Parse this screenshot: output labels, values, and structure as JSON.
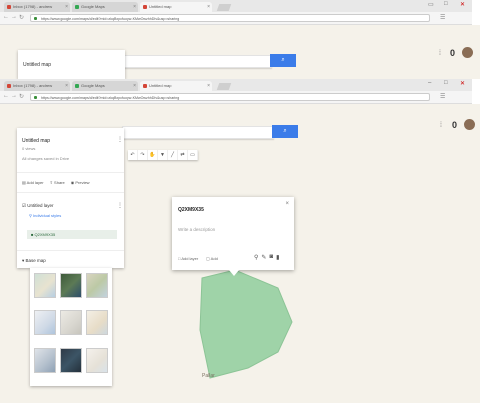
{
  "browser_back": {
    "tabs": [
      {
        "label": "Inbox (1798) - andrew",
        "favicon_color": "#d44638"
      },
      {
        "label": "Google Maps",
        "favicon_color": "#34a853"
      },
      {
        "label": "Untitled map",
        "favicon_color": "#d44638"
      }
    ],
    "url": "https://www.google.com/maps/d/edit?mid=zkqBxpcfuoyw-KMwOwzhhDIv&usp=sharing",
    "map_title": "Untitled map"
  },
  "browser": {
    "tabs": [
      {
        "label": "Inbox (1798) - andrew",
        "favicon_color": "#d44638"
      },
      {
        "label": "Google Maps",
        "favicon_color": "#34a853"
      },
      {
        "label": "Untitled map",
        "favicon_color": "#d44638"
      }
    ],
    "url": "https://www.google.com/maps/d/edit?mid=zkqBxpcfuoyw-KMwOwzhhDIv&usp=sharing",
    "window_controls": [
      "–",
      "□",
      "✕"
    ],
    "nav": [
      "←",
      "→",
      "↻"
    ]
  },
  "colors": {
    "accent": "#3b7ce9",
    "polygon_fill": "#9fd3a8",
    "map_bg": "#f5f2ea"
  },
  "icons": {
    "search": "⌕",
    "menu": "☰"
  },
  "map_panel": {
    "title": "Untitled map",
    "views": "0 views",
    "saved_status": "All changes saved in Drive",
    "actions": [
      "Add layer",
      "Share",
      "Preview"
    ],
    "layer": {
      "name": "Untitled layer",
      "style": "Individual styles",
      "feature": "Q2XM9X35"
    },
    "base_map_label": "Base map"
  },
  "popup": {
    "title": "Q2XM9X35",
    "description": "Write a description",
    "footer_left": "Add layer",
    "footer_mid": "Add"
  },
  "map_label": "Pallar",
  "toolbar_icons": [
    "undo",
    "redo",
    "hand",
    "marker",
    "line",
    "directions",
    "ruler"
  ],
  "toolbar_glyphs": [
    "↶",
    "↷",
    "✋",
    "▼",
    "╱",
    "⇄",
    "▭"
  ]
}
